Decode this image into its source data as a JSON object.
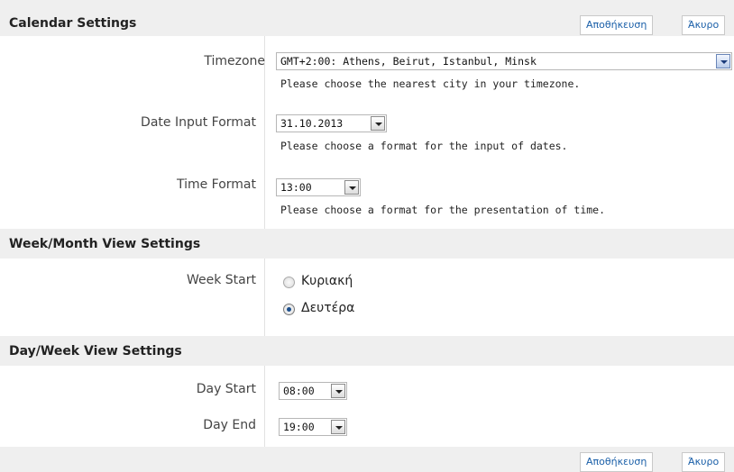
{
  "calendar_settings": {
    "title": "Calendar Settings",
    "timezone": {
      "label": "Timezone",
      "value": "GMT+2:00: Athens, Beirut, Istanbul, Minsk",
      "hint": "Please choose the nearest city in your timezone."
    },
    "date_input_format": {
      "label": "Date Input Format",
      "value": "31.10.2013",
      "hint": "Please choose a format for the input of dates."
    },
    "time_format": {
      "label": "Time Format",
      "value": "13:00",
      "hint": "Please choose a format for the presentation of time."
    }
  },
  "week_month_settings": {
    "title": "Week/Month View Settings",
    "week_start": {
      "label": "Week Start",
      "options": [
        {
          "label": "Κυριακή",
          "checked": false
        },
        {
          "label": "Δευτέρα",
          "checked": true
        }
      ]
    }
  },
  "day_week_settings": {
    "title": "Day/Week View Settings",
    "day_start": {
      "label": "Day Start",
      "value": "08:00"
    },
    "day_end": {
      "label": "Day End",
      "value": "19:00"
    }
  },
  "buttons": {
    "save": "Αποθήκευση",
    "cancel": "Άκυρο"
  }
}
